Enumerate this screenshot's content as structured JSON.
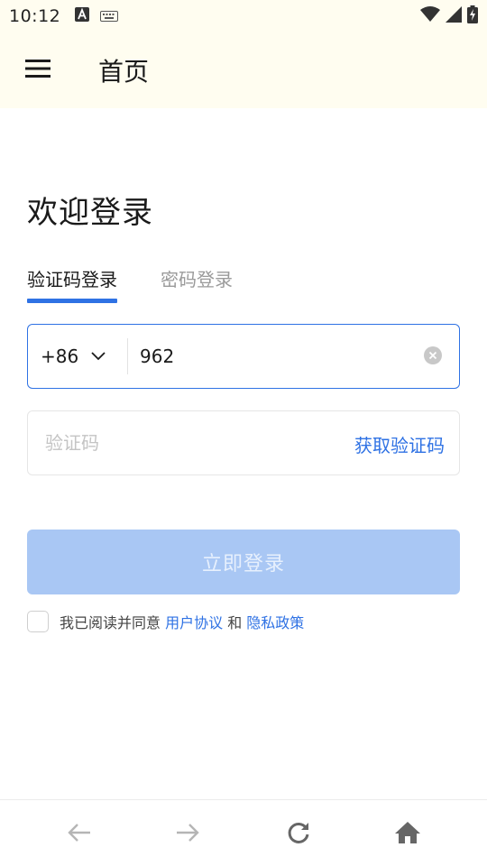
{
  "status_bar": {
    "time": "10:12",
    "icons": [
      "a-box-icon",
      "keyboard-icon",
      "wifi-icon",
      "cell-signal-icon",
      "battery-charging-icon"
    ]
  },
  "app_bar": {
    "title": "首页",
    "menu_icon": "menu-icon"
  },
  "login": {
    "welcome": "欢迎登录",
    "tabs": [
      {
        "label": "验证码登录",
        "active": true
      },
      {
        "label": "密码登录",
        "active": false
      }
    ],
    "country_code": "+86",
    "phone_value": "962",
    "code_placeholder": "验证码",
    "get_code_label": "获取验证码",
    "submit_label": "立即登录",
    "agree": {
      "prefix": "我已阅读并同意 ",
      "user_agreement": "用户协议",
      "and": " 和 ",
      "privacy_policy": "隐私政策",
      "checked": false
    }
  },
  "bottom_nav": {
    "icons": [
      "back-arrow-icon",
      "forward-arrow-icon",
      "refresh-icon",
      "home-icon"
    ]
  },
  "colors": {
    "accent": "#2f72e4",
    "button_disabled_bg": "#a9c7f4",
    "header_bg": "#fffdf0"
  }
}
